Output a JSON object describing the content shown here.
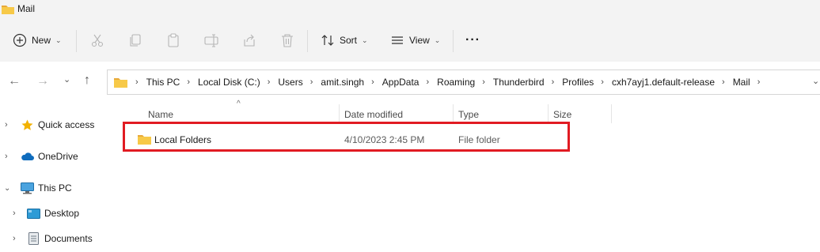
{
  "window": {
    "title": "Mail"
  },
  "toolbar": {
    "new_label": "New",
    "sort_label": "Sort",
    "view_label": "View",
    "more_label": "···"
  },
  "address": {
    "crumbs": [
      "This PC",
      "Local Disk (C:)",
      "Users",
      "amit.singh",
      "AppData",
      "Roaming",
      "Thunderbird",
      "Profiles",
      "cxh7ayj1.default-release",
      "Mail"
    ]
  },
  "sidebar": {
    "items": [
      {
        "label": "Quick access"
      },
      {
        "label": "OneDrive"
      },
      {
        "label": "This PC"
      },
      {
        "label": "Desktop"
      },
      {
        "label": "Documents"
      }
    ]
  },
  "columns": {
    "name": "Name",
    "date": "Date modified",
    "type": "Type",
    "size": "Size"
  },
  "files": [
    {
      "name": "Local Folders",
      "date": "4/10/2023 2:45 PM",
      "type": "File folder",
      "size": ""
    }
  ],
  "colors": {
    "highlight": "#e11b22",
    "folder": "#f4c542",
    "accent": "#0067c0"
  }
}
